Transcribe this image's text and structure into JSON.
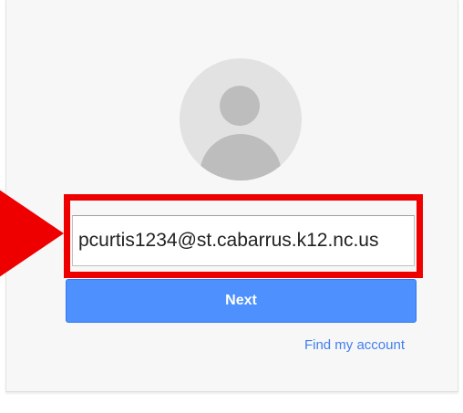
{
  "login": {
    "email_value": "pcurtis1234@st.cabarrus.k12.nc.us",
    "next_label": "Next",
    "find_account_label": "Find my account"
  },
  "colors": {
    "highlight": "#ee0000",
    "primary_button": "#4d90fe",
    "link": "#427fed",
    "card_background": "#f7f7f7",
    "avatar_background": "#e2e2e2",
    "avatar_silhouette": "#bdbdbd"
  },
  "icons": {
    "avatar": "default-user-avatar-icon",
    "pointer": "red-arrow-pointer"
  }
}
